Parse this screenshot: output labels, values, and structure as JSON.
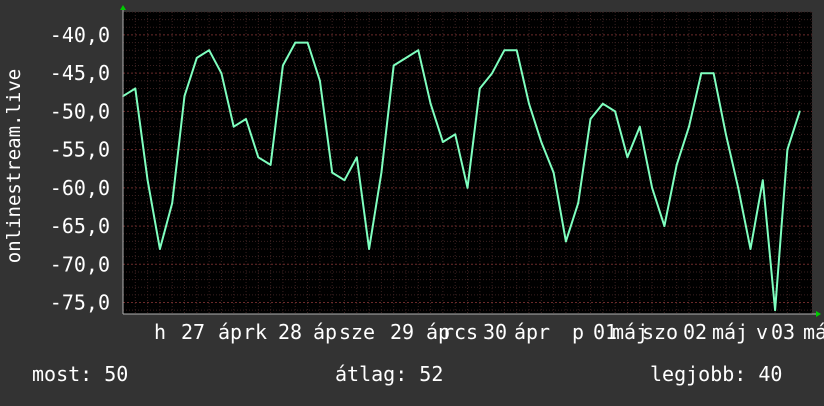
{
  "chart_data": {
    "type": "line",
    "ylabel": "onlinestream.live",
    "ylim": [
      -76.5,
      -37.0
    ],
    "y_ticks": [
      "-40,0",
      "-45,0",
      "-50,0",
      "-55,0",
      "-60,0",
      "-65,0",
      "-70,0",
      "-75,0"
    ],
    "y_tick_values": [
      -40,
      -45,
      -50,
      -55,
      -60,
      -65,
      -70,
      -75
    ],
    "x_labels": [
      "h 27 ápr",
      "k 28 ápr",
      "sze 29 ápr",
      "cs 30 ápr",
      "p 01 máj",
      "szo 02 máj",
      "v 03 máj"
    ],
    "x_label_text": [
      "h",
      "27",
      "áp",
      "rk",
      "28",
      "áp",
      "sze",
      "29",
      "áp",
      "rcs",
      "30",
      "ápr",
      "p",
      "01",
      "máj",
      "szo",
      "02",
      "máj",
      "v",
      "03",
      "má"
    ],
    "x": [
      "2025-04-26 18:00",
      "2025-04-26 21:00",
      "2025-04-27 00:00",
      "2025-04-27 03:00",
      "2025-04-27 06:00",
      "2025-04-27 09:00",
      "2025-04-27 12:00",
      "2025-04-27 15:00",
      "2025-04-27 18:00",
      "2025-04-27 21:00",
      "2025-04-28 00:00",
      "2025-04-28 03:00",
      "2025-04-28 06:00",
      "2025-04-28 09:00",
      "2025-04-28 12:00",
      "2025-04-28 15:00",
      "2025-04-28 18:00",
      "2025-04-28 21:00",
      "2025-04-29 00:00",
      "2025-04-29 03:00",
      "2025-04-29 06:00",
      "2025-04-29 09:00",
      "2025-04-29 12:00",
      "2025-04-29 15:00",
      "2025-04-29 18:00",
      "2025-04-29 21:00",
      "2025-04-30 00:00",
      "2025-04-30 03:00",
      "2025-04-30 06:00",
      "2025-04-30 09:00",
      "2025-04-30 12:00",
      "2025-04-30 15:00",
      "2025-04-30 18:00",
      "2025-04-30 21:00",
      "2025-05-01 00:00",
      "2025-05-01 03:00",
      "2025-05-01 06:00",
      "2025-05-01 09:00",
      "2025-05-01 12:00",
      "2025-05-01 15:00",
      "2025-05-01 18:00",
      "2025-05-01 21:00",
      "2025-05-02 00:00",
      "2025-05-02 03:00",
      "2025-05-02 06:00",
      "2025-05-02 09:00",
      "2025-05-02 12:00",
      "2025-05-02 15:00",
      "2025-05-02 18:00",
      "2025-05-02 21:00",
      "2025-05-03 00:00",
      "2025-05-03 03:00",
      "2025-05-03 06:00",
      "2025-05-03 09:00",
      "2025-05-03 12:00",
      "2025-05-03 15:00"
    ],
    "series": [
      {
        "color": "#7fffbf",
        "values": [
          -48,
          -47,
          -59,
          -68,
          -62,
          -48,
          -43,
          -42,
          -45,
          -52,
          -51,
          -56,
          -57,
          -44,
          -41,
          -41,
          -46,
          -58,
          -59,
          -56,
          -68,
          -58,
          -44,
          -43,
          -42,
          -49,
          -54,
          -53,
          -60,
          -47,
          -45,
          -42,
          -42,
          -49,
          -54,
          -58,
          -67,
          -62,
          -51,
          -49,
          -50,
          -56,
          -52,
          -60,
          -65,
          -57,
          -52,
          -45,
          -45,
          -53,
          -60,
          -68,
          -59,
          -76,
          -55,
          -50
        ]
      }
    ],
    "grid": true
  },
  "legend": {
    "current_label": "most:",
    "current_value": "50",
    "average_label": "átlag:",
    "average_value": "52",
    "best_label": "legjobb:",
    "best_value": "40"
  }
}
